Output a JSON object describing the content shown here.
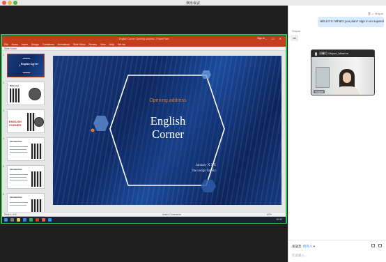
{
  "window": {
    "title": "演示会议"
  },
  "ppt": {
    "title": "English Corner Opening address - PowerPoint",
    "user": "Sign in",
    "menu": [
      "File",
      "Home",
      "Insert",
      "Design",
      "Transitions",
      "Animations",
      "Slide Show",
      "Review",
      "View",
      "Help",
      "Tell me"
    ],
    "ribbon_text": "Slide Sorter",
    "status_left": "Slide 1 of 6",
    "status_right": "Notes  Comments",
    "zoom": "82%",
    "taskbar_time": "10:32"
  },
  "thumbs": [
    {
      "num": "1",
      "title": "English Corner"
    },
    {
      "num": "2",
      "title": "Welcome"
    },
    {
      "num": "3",
      "title": "ENGLISH CORNER"
    },
    {
      "num": "4",
      "title": "Introduction"
    },
    {
      "num": "5",
      "title": "Introduction"
    },
    {
      "num": "6",
      "title": "Introduction"
    }
  ],
  "slide": {
    "subtitle": "Opening address",
    "title_line1": "English",
    "title_line2": "Corner",
    "meta_line1": "January X XX",
    "meta_line2": "the congo family"
  },
  "chat": {
    "sender": "我 -> Shiyue",
    "message": "HELLO 5. What's you plan? sign in on superstar",
    "sender2": "Shiyue",
    "reply": "ok",
    "video_name": "邓馨月 Shiyue_Minerva",
    "video_label": "Shiyue",
    "send_label": "发送至:",
    "send_target": "所有人",
    "input_placeholder": "在此输入..."
  },
  "colors": {
    "ppt_accent": "#c43e1c",
    "share_border": "#32c253",
    "slide_orange": "#e07a2e"
  }
}
